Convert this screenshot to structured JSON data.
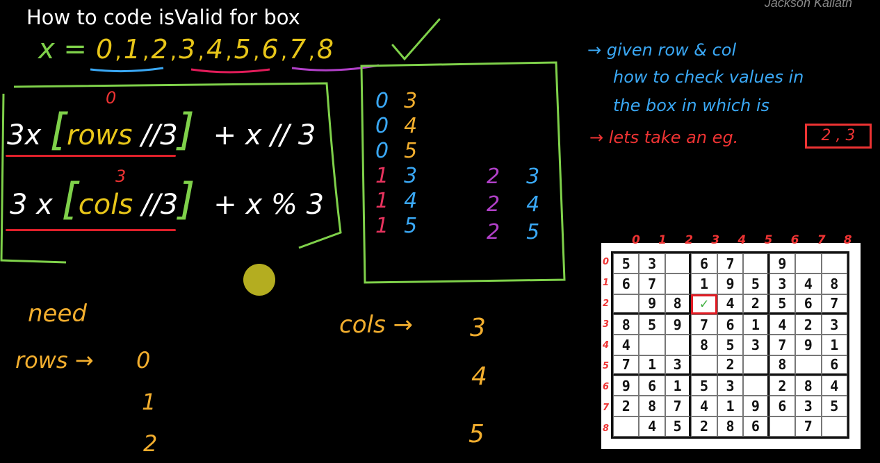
{
  "title": "How to code isValid for box",
  "watermark": "Jackson Kailath",
  "x_sequence": {
    "label": "x =",
    "values": [
      "0",
      "1",
      "2",
      "3",
      "4",
      "5",
      "6",
      "7",
      "8"
    ]
  },
  "formulas": {
    "row_formula": {
      "prefix": "3x",
      "inner": "rows",
      "marker": "0",
      "div": "//3",
      "suffix": "+ x // 3"
    },
    "col_formula": {
      "prefix": "3 x",
      "inner": "cols",
      "marker": "3",
      "div": "//3",
      "suffix": "+ x % 3"
    }
  },
  "pairs_left": [
    {
      "r": "0",
      "c": "3"
    },
    {
      "r": "0",
      "c": "4"
    },
    {
      "r": "0",
      "c": "5"
    },
    {
      "r": "1",
      "c": "3"
    },
    {
      "r": "1",
      "c": "4"
    },
    {
      "r": "1",
      "c": "5"
    }
  ],
  "pairs_right": [
    {
      "r": "2",
      "c": "3"
    },
    {
      "r": "2",
      "c": "4"
    },
    {
      "r": "2",
      "c": "5"
    }
  ],
  "notes": {
    "line1": "→ given row & col",
    "line2": "how to check values in",
    "line3": "the box in which is",
    "line4": "→ lets take an eg.",
    "example": "2 , 3"
  },
  "need": {
    "label": "need",
    "rows_label": "rows →",
    "rows_values": [
      "0",
      "1",
      "2"
    ],
    "cols_label": "cols →",
    "cols_values": [
      "3",
      "4",
      "5"
    ]
  },
  "sudoku": {
    "col_labels": [
      "0",
      "1",
      "2",
      "3",
      "4",
      "5",
      "6",
      "7",
      "8"
    ],
    "row_labels": [
      "0",
      "1",
      "2",
      "3",
      "4",
      "5",
      "6",
      "7",
      "8"
    ],
    "grid": [
      [
        "5",
        "3",
        "",
        "6",
        "7",
        "",
        "9",
        "",
        ""
      ],
      [
        "6",
        "7",
        "",
        "1",
        "9",
        "5",
        "3",
        "4",
        "8"
      ],
      [
        "",
        "9",
        "8",
        "✓",
        "4",
        "2",
        "5",
        "6",
        "7"
      ],
      [
        "8",
        "5",
        "9",
        "7",
        "6",
        "1",
        "4",
        "2",
        "3"
      ],
      [
        "4",
        "",
        "",
        "8",
        "5",
        "3",
        "7",
        "9",
        "1"
      ],
      [
        "7",
        "1",
        "3",
        "",
        "2",
        "",
        "8",
        "",
        "6"
      ],
      [
        "9",
        "6",
        "1",
        "5",
        "3",
        "",
        "2",
        "8",
        "4"
      ],
      [
        "2",
        "8",
        "7",
        "4",
        "1",
        "9",
        "6",
        "3",
        "5"
      ],
      [
        "",
        "4",
        "5",
        "2",
        "8",
        "6",
        "",
        "7",
        ""
      ]
    ]
  },
  "colors": {
    "white": "#ffffff",
    "green": "#7fd14a",
    "yellow": "#e8c619",
    "orange": "#f2ae2e",
    "blue": "#3aa8f5",
    "red": "#e33333",
    "purple": "#b140c8"
  }
}
